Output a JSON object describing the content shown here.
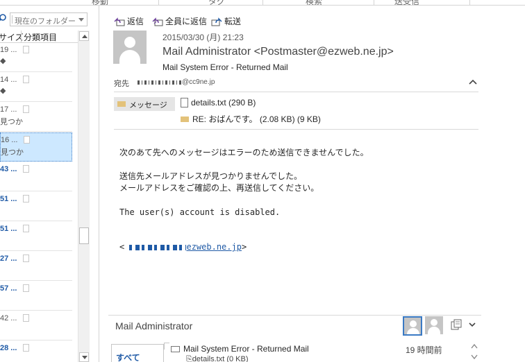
{
  "ribbon": {
    "labels": [
      "移動",
      "タグ",
      "検索",
      "送受信"
    ]
  },
  "list": {
    "scope": "現在のフォルダー",
    "col_size": "サイズ",
    "col_category": "分類項目",
    "rows": [
      {
        "size": "19 ...",
        "sub": "◆",
        "bold": false,
        "selected": false
      },
      {
        "size": "14 ...",
        "sub": "◆",
        "bold": false,
        "selected": false
      },
      {
        "size": "17 ...",
        "sub": "見つか",
        "bold": false,
        "selected": false
      },
      {
        "size": "16 ...",
        "sub": "見つか",
        "bold": false,
        "selected": true
      },
      {
        "size": "43 ...",
        "sub": "",
        "bold": true,
        "selected": false
      },
      {
        "size": "51 ...",
        "sub": "",
        "bold": true,
        "selected": false
      },
      {
        "size": "51 ...",
        "sub": "",
        "bold": true,
        "selected": false
      },
      {
        "size": "27 ...",
        "sub": "",
        "bold": true,
        "selected": false
      },
      {
        "size": "57 ...",
        "sub": "",
        "bold": true,
        "selected": false
      },
      {
        "size": "42 ...",
        "sub": "",
        "bold": false,
        "selected": false
      },
      {
        "size": "28 ...",
        "sub": "",
        "bold": true,
        "selected": false
      }
    ]
  },
  "reading": {
    "actions": {
      "reply": "返信",
      "reply_all": "全員に返信",
      "forward": "転送"
    },
    "date": "2015/03/30 (月) 21:23",
    "from": "Mail Administrator <Postmaster@ezweb.ne.jp>",
    "subject": "Mail System Error - Returned Mail",
    "to_label": "宛先",
    "to_value": "@cc9ne.jp",
    "att_message": "メッセージ",
    "att_details": "details.txt (290 B)",
    "att_forwarded": "RE: おばんです。 (2.08 KB) (9 KB)",
    "body": {
      "line1": "次のあて先へのメッセージはエラーのため送信できませんでした。",
      "line2": "送信先メールアドレスが見つかりませんでした。",
      "line3": "メールアドレスをご確認の上、再送信してください。",
      "line4": "The user(s) account is disabled.",
      "sig_open": "<",
      "sig_link": "ezweb.ne.jp",
      "sig_close": ">"
    },
    "footer": {
      "person": "Mail Administrator",
      "tab_all": "すべて",
      "conv_subject": "Mail System Error - Returned Mail",
      "conv_time": "19 時間前",
      "conv_attachment": "details.txt (0 KB)"
    }
  },
  "colors": {
    "accent": "#1f5aa6",
    "selection": "#cde8ff",
    "envelope": "#e3c27a"
  }
}
